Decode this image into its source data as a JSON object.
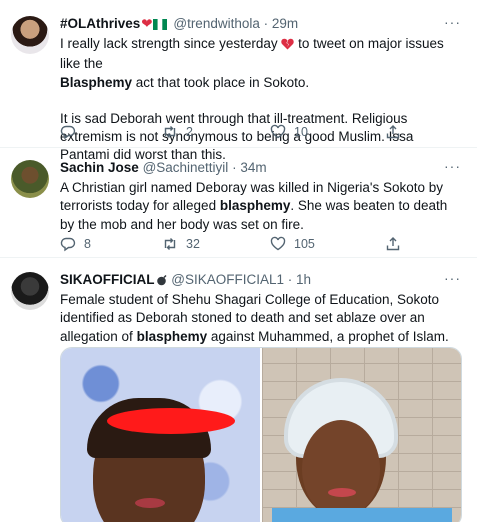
{
  "tweets": [
    {
      "name": "#OLAthrives",
      "handle": "@trendwithola",
      "time": "29m",
      "more": "···",
      "line1_pre": "I really lack strength since yesterday",
      "line1_post": "to tweet on major issues like the",
      "line2_bold": "Blasphemy",
      "line2_post": "act that took place in Sokoto.",
      "para2": "It is sad Deborah went through that ill-treatment. Religious extremism is not synonymous to being a good Muslim. Issa Pantami did worst than this.",
      "counts": {
        "reply": "",
        "retweet": "2",
        "like": "10"
      }
    },
    {
      "name": "Sachin Jose",
      "handle": "@Sachinettiyil",
      "time": "34m",
      "more": "···",
      "text_pre": "A Christian girl named Deboray was killed in Nigeria's Sokoto by terrorists today for alleged",
      "text_bold": "blasphemy",
      "text_post": ". She was beaten to death by the mob and her body was set on fire.",
      "counts": {
        "reply": "8",
        "retweet": "32",
        "like": "105"
      }
    },
    {
      "name": "SIKAOFFICIAL",
      "handle": "@SIKAOFFICIAL1",
      "time": "1h",
      "more": "···",
      "text_pre": "Female student of Shehu Shagari College of Education, Sokoto identified as Deborah stoned to death and set ablaze over an allegation of",
      "text_bold": "blasphemy",
      "text_post": "against Muhammed, a prophet of Islam."
    }
  ],
  "colors": {
    "secondary_text": "#536471",
    "divider": "#eff3f4",
    "redaction": "#ff1a1a"
  },
  "icons": [
    "broken-heart-icon",
    "nigeria-flag-icon",
    "reply-icon",
    "retweet-icon",
    "like-icon",
    "share-icon",
    "bomb-icon"
  ]
}
